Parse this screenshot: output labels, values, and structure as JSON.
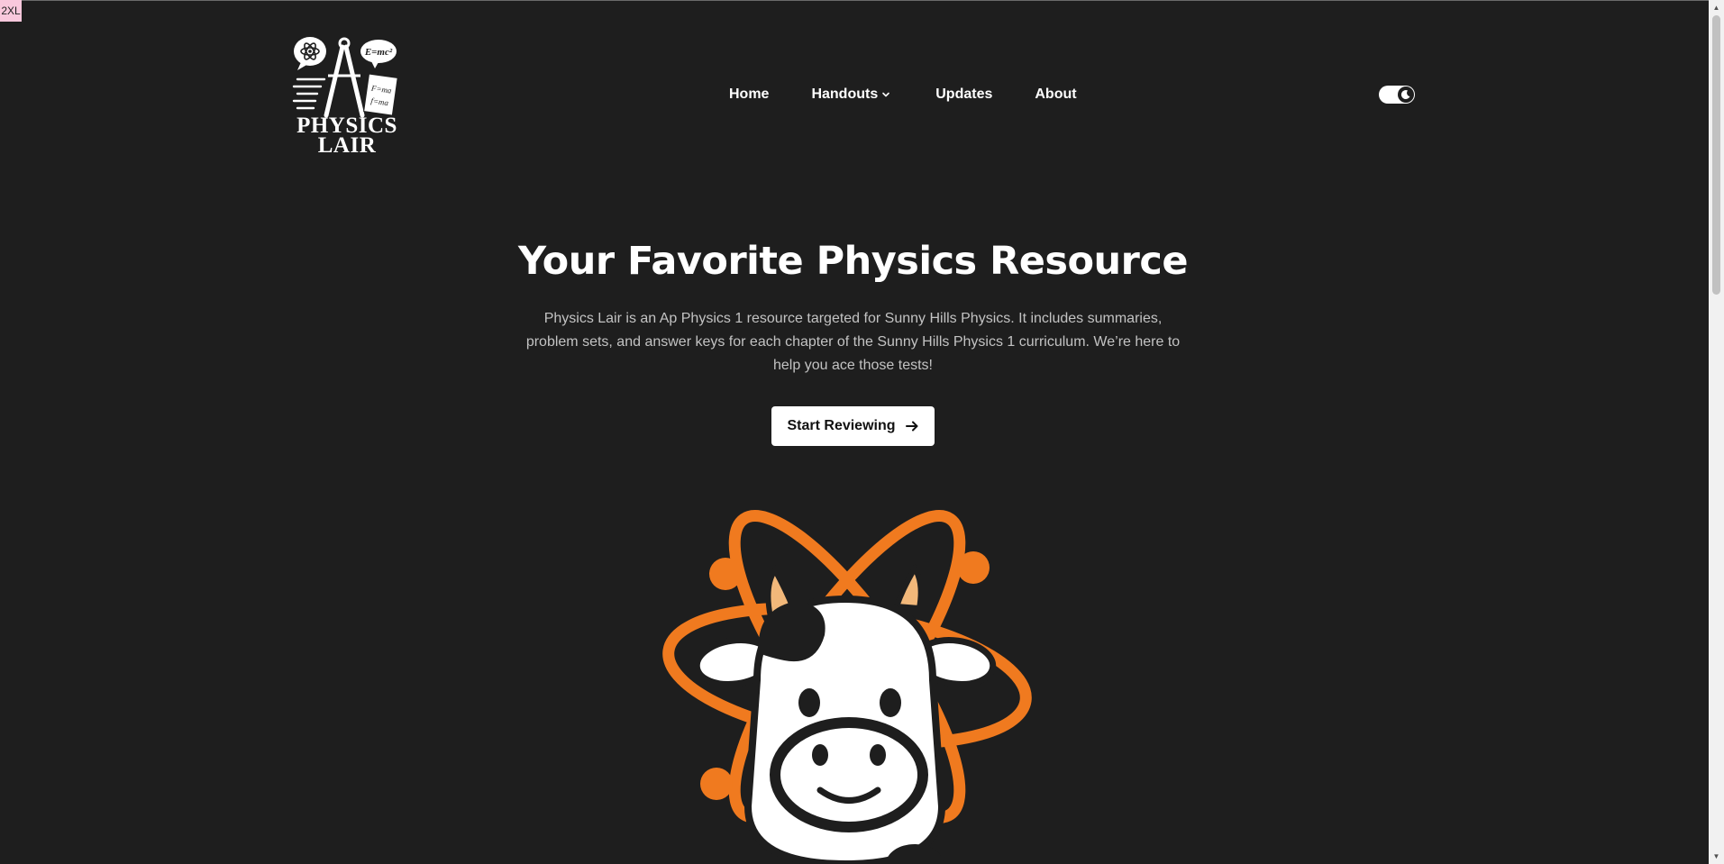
{
  "breakpoint_badge": "2XL",
  "logo": {
    "line1": "PHYSICS",
    "line2": "LAIR",
    "bubble_text": "E=mc²",
    "paper_text_1": "F=ma",
    "paper_text_2": "f=ma"
  },
  "nav": {
    "items": [
      {
        "label": "Home"
      },
      {
        "label": "Handouts"
      },
      {
        "label": "Updates"
      },
      {
        "label": "About"
      }
    ]
  },
  "theme_toggle": {
    "icon": "moon-icon",
    "state": "dark"
  },
  "hero": {
    "title": "Your Favorite Physics Resource",
    "description": "Physics Lair is an Ap Physics 1 resource targeted for Sunny Hills Physics. It includes summaries, problem sets, and answer keys for each chapter of the Sunny Hills Physics 1 curriculum. We’re here to help you ace those tests!",
    "cta_label": "Start Reviewing",
    "cta_icon": "arrow-right-icon"
  },
  "colors": {
    "background": "#1e1e1e",
    "accent_orange": "#f07a1f",
    "text_primary": "#ffffff",
    "text_secondary": "#c3c3c3"
  }
}
